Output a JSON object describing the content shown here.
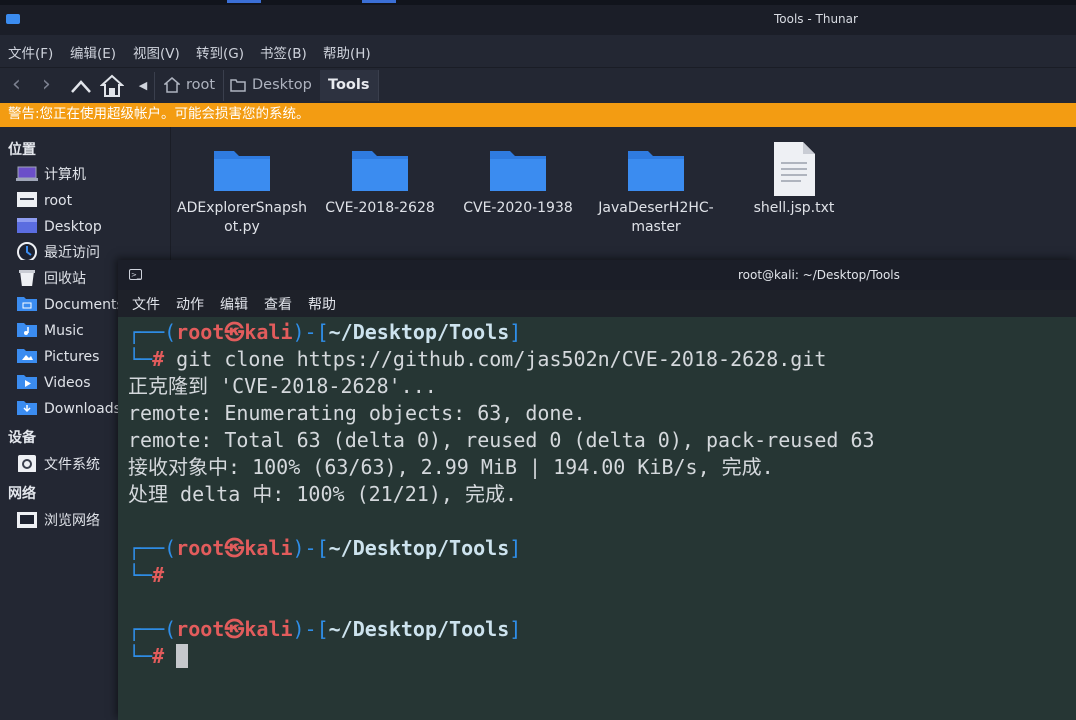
{
  "thunar": {
    "title": "Tools - Thunar",
    "menu": [
      "文件(F)",
      "编辑(E)",
      "视图(V)",
      "转到(G)",
      "书签(B)",
      "帮助(H)"
    ],
    "breadcrumbs": [
      "root",
      "Desktop",
      "Tools"
    ],
    "warning": "警告:您正在使用超级帐户。可能会损害您的系统。",
    "sidebar": {
      "places_heading": "位置",
      "places": [
        "计算机",
        "root",
        "Desktop",
        "最近访问",
        "回收站",
        "Documents",
        "Music",
        "Pictures",
        "Videos",
        "Downloads"
      ],
      "devices_heading": "设备",
      "devices": [
        "文件系统"
      ],
      "network_heading": "网络",
      "network": [
        "浏览网络"
      ]
    },
    "files": [
      {
        "name": "ADExplorerSnapsh\not.py",
        "icon": "folder-icon"
      },
      {
        "name": "CVE-2018-2628",
        "icon": "folder-icon"
      },
      {
        "name": "CVE-2020-1938",
        "icon": "folder-icon"
      },
      {
        "name": "JavaDeserH2HC-\nmaster",
        "icon": "folder-icon"
      },
      {
        "name": "shell.jsp.txt",
        "icon": "text-file-icon"
      }
    ]
  },
  "terminal": {
    "title": "root@kali: ~/Desktop/Tools",
    "menu": [
      "文件",
      "动作",
      "编辑",
      "查看",
      "帮助"
    ],
    "prompt": {
      "open": "┌──(",
      "user": "root",
      "at": "㉿",
      "host": "kali",
      "mid": ")-[",
      "path": "~/Desktop/Tools",
      "close": "]",
      "corner": "└─",
      "hash": "#"
    },
    "command": " git clone https://github.com/jas502n/CVE-2018-2628.git",
    "output": [
      "正克隆到 'CVE-2018-2628'...",
      "remote: Enumerating objects: 63, done.",
      "remote: Total 63 (delta 0), reused 0 (delta 0), pack-reused 63",
      "接收对象中: 100% (63/63), 2.99 MiB | 194.00 KiB/s, 完成.",
      "处理 delta 中: 100% (21/21), 完成."
    ]
  },
  "colors": {
    "warning_bg": "#f39c12",
    "folder": "#3b8cf0",
    "prompt_user": "#e25c5c",
    "prompt_frame": "#2f8ee8",
    "terminal_bg": "#263634"
  }
}
